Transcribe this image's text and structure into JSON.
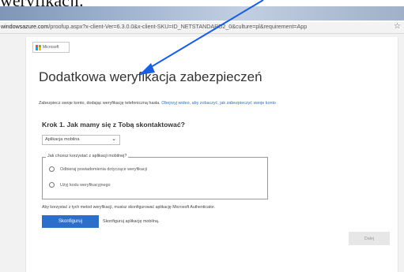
{
  "caption": {
    "text": "weryfikacji."
  },
  "browser": {
    "url_host": "windowsazure.com",
    "url_path": "/proofup.aspx?x-client-Ver=6.3.0.0&x-client-SKU=ID_NETSTANDARD2_0&culture=pl&requirement=App",
    "star_icon": "☆"
  },
  "logo": {
    "text": "Microsoft"
  },
  "page": {
    "title": "Dodatkowa weryfikacja zabezpieczeń",
    "intro_text": "Zabezpiecz swoje konto, dodając weryfikację telefoniczną hasła.",
    "intro_link": "Obejrzyj wideo, aby zobaczyć, jak zabezpieczyć swoje konto",
    "step_heading": "Krok 1. Jak mamy się z Tobą skontaktować?",
    "select_value": "Aplikacja mobilna",
    "legend": "Jak chcesz korzystać z aplikacji mobilnej?",
    "radio_options": [
      {
        "label": "Odbieraj powiadomienia dotyczące weryfikacji"
      },
      {
        "label": "Użyj kodu weryfikacyjnego"
      }
    ],
    "note": "Aby korzystać z tych metod weryfikacji, musisz skonfigurować aplikację Microsoft Authenticator.",
    "configure_button": "Skonfiguruj",
    "configure_hint": "Skonfiguruj aplikację mobilną.",
    "next_button": "Dalej"
  },
  "colors": {
    "accent": "#2c6ec9",
    "arrow": "#1a5fe0"
  }
}
